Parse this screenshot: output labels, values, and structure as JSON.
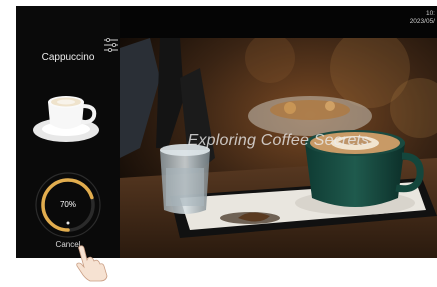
{
  "status_bar": {
    "time": "10:",
    "date": "2023/05/"
  },
  "drink": {
    "name": "Cappuccino"
  },
  "progress": {
    "percent_label": "70%",
    "fraction": 0.7
  },
  "actions": {
    "cancel_label": "Cancel"
  },
  "photo": {
    "caption": "Exploring Coffee Secrets"
  },
  "icons": {
    "settings": "sliders-icon",
    "drink": "coffee-cup-icon",
    "pointer": "hand-pointer-icon"
  },
  "colors": {
    "accent": "#e2ad4e",
    "screen_bg": "#050505",
    "text": "#ececec"
  }
}
